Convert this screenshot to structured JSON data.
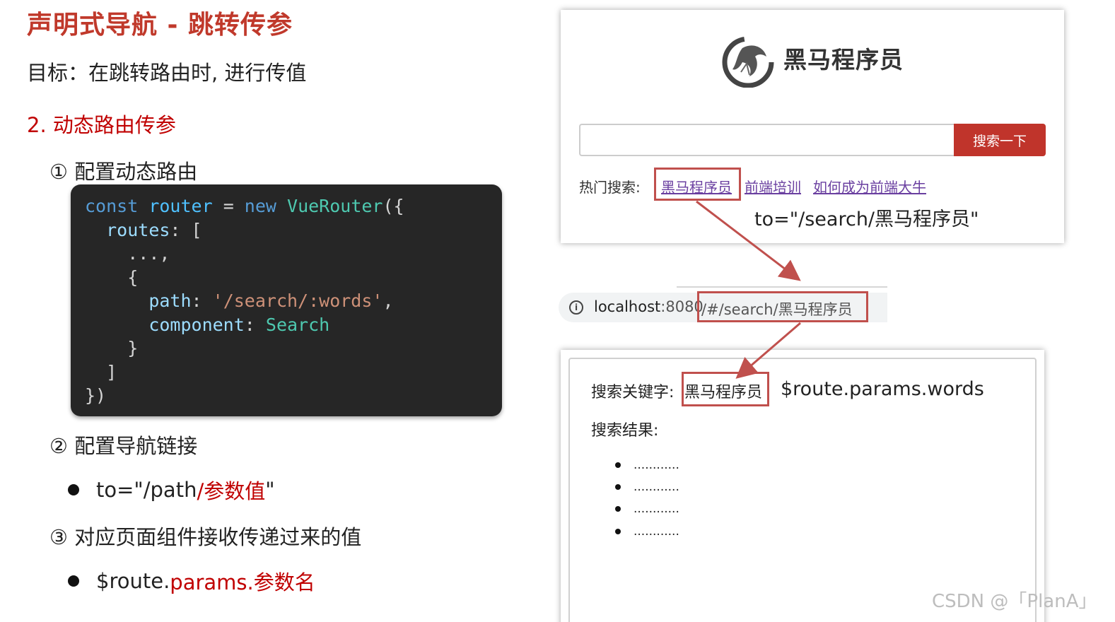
{
  "slide": {
    "title": "声明式导航 - 跳转传参",
    "goal": "目标：在跳转路由时, 进行传值",
    "section": "2. 动态路由传参",
    "step1": "① 配置动态路由",
    "step2": "② 配置导航链接",
    "step3": "③ 对应页面组件接收传递过来的值",
    "bullet1": {
      "prefix": "to=\"/path",
      "highlight": "/参数值",
      "suffix": "\""
    },
    "bullet2": {
      "prefix": "$route.",
      "highlight": "params.参数名"
    }
  },
  "code": {
    "line1": {
      "kw": "const",
      "var": "router",
      "op": " = ",
      "kw2": "new",
      "cls": "VueRouter",
      "tail": "({"
    },
    "line2": {
      "prop": "routes",
      "tail": ": ["
    },
    "line3": "...,",
    "line4": "{",
    "line5": {
      "prop": "path",
      "sep": ": ",
      "str": "'/search/:words'",
      "tail": ","
    },
    "line6": {
      "prop": "component",
      "sep": ": ",
      "val": "Search"
    },
    "line7": "}",
    "line8": "]",
    "line9": "})"
  },
  "site": {
    "brand": "黑马程序员",
    "search_button": "搜索一下",
    "hot_label": "热门搜索:",
    "hot_links": [
      "黑马程序员",
      "前端培训",
      "如何成为前端大牛"
    ],
    "to_annotation": "to=\"/search/黑马程序员\""
  },
  "urlbar": {
    "host": "localhost",
    "port": ":8080",
    "path": "/#/search/黑马程序员"
  },
  "result_page": {
    "keyword_label": "搜索关键字:",
    "keyword_value": "黑马程序员",
    "route_annotation": "$route.params.words",
    "result_label": "搜索结果:",
    "items": [
      "............",
      "............",
      "............",
      "............"
    ]
  },
  "colors": {
    "accent": "#c00000",
    "highlight_box": "#c0504d",
    "button": "#c0342b",
    "code_bg": "#262626"
  },
  "watermark": "CSDN @「PlanA」"
}
